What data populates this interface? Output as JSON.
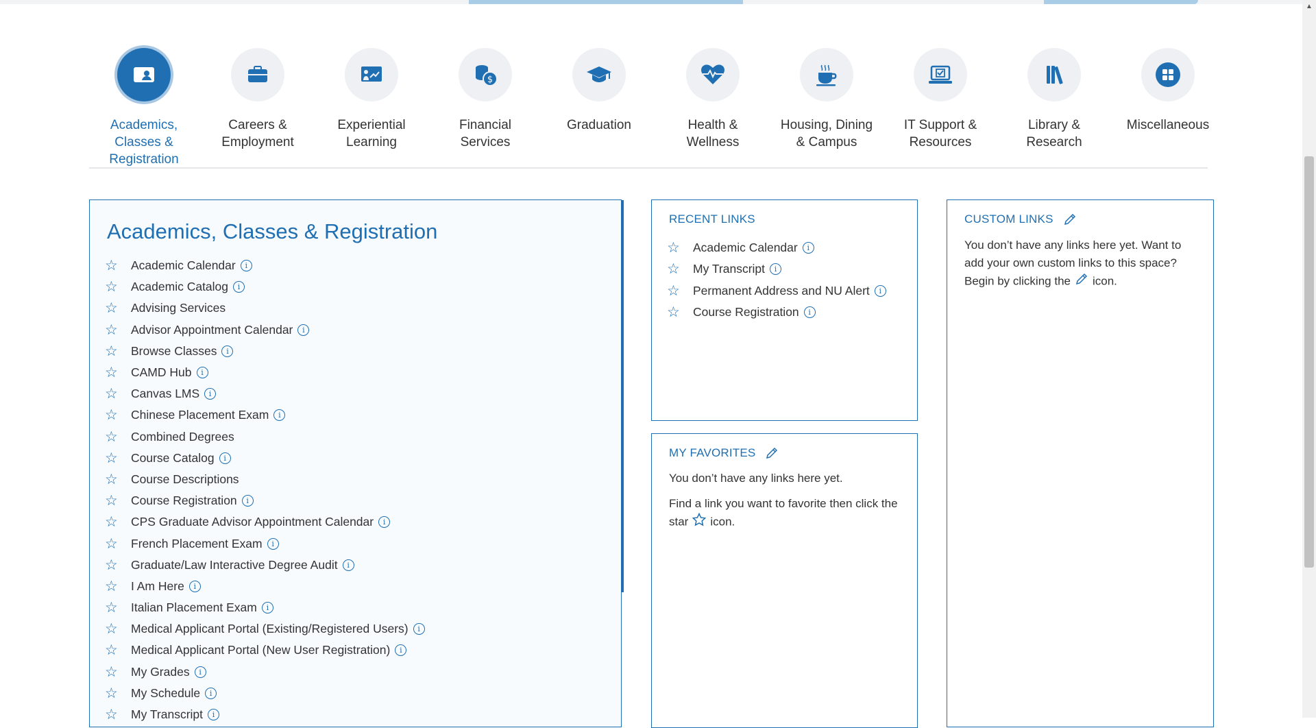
{
  "categories": [
    {
      "label": "Academics,\nClasses &\nRegistration",
      "icon": "id-card-icon",
      "active": true
    },
    {
      "label": "Careers &\nEmployment",
      "icon": "briefcase-icon"
    },
    {
      "label": "Experiential\nLearning",
      "icon": "presentation-icon"
    },
    {
      "label": "Financial\nServices",
      "icon": "coins-icon"
    },
    {
      "label": "Graduation",
      "icon": "graduation-cap-icon"
    },
    {
      "label": "Health &\nWellness",
      "icon": "heartbeat-icon"
    },
    {
      "label": "Housing, Dining\n& Campus",
      "icon": "coffee-cup-icon"
    },
    {
      "label": "IT Support &\nResources",
      "icon": "laptop-icon"
    },
    {
      "label": "Library &\nResearch",
      "icon": "books-icon"
    },
    {
      "label": "Miscellaneous",
      "icon": "grid-icon"
    }
  ],
  "main": {
    "title": "Academics, Classes & Registration",
    "links": [
      {
        "label": "Academic Calendar",
        "info": true
      },
      {
        "label": "Academic Catalog",
        "info": true
      },
      {
        "label": "Advising Services",
        "info": false
      },
      {
        "label": "Advisor Appointment Calendar",
        "info": true
      },
      {
        "label": "Browse Classes",
        "info": true
      },
      {
        "label": "CAMD Hub",
        "info": true
      },
      {
        "label": "Canvas LMS",
        "info": true
      },
      {
        "label": "Chinese Placement Exam",
        "info": true
      },
      {
        "label": "Combined Degrees",
        "info": false
      },
      {
        "label": "Course Catalog",
        "info": true
      },
      {
        "label": "Course Descriptions",
        "info": false
      },
      {
        "label": "Course Registration",
        "info": true
      },
      {
        "label": "CPS Graduate Advisor Appointment Calendar",
        "info": true
      },
      {
        "label": "French Placement Exam",
        "info": true
      },
      {
        "label": "Graduate/Law Interactive Degree Audit",
        "info": true
      },
      {
        "label": "I Am Here",
        "info": true
      },
      {
        "label": "Italian Placement Exam",
        "info": true
      },
      {
        "label": "Medical Applicant Portal (Existing/Registered Users)",
        "info": true
      },
      {
        "label": "Medical Applicant Portal (New User Registration)",
        "info": true
      },
      {
        "label": "My Grades",
        "info": true
      },
      {
        "label": "My Schedule",
        "info": true
      },
      {
        "label": "My Transcript",
        "info": true
      }
    ]
  },
  "recent": {
    "heading": "RECENT LINKS",
    "links": [
      {
        "label": "Academic Calendar"
      },
      {
        "label": "My Transcript"
      },
      {
        "label": "Permanent Address and NU Alert"
      },
      {
        "label": "Course Registration"
      }
    ]
  },
  "favorites": {
    "heading": "MY FAVORITES",
    "empty": "You don’t have any links here yet.",
    "hint_before": "Find a link you want to favorite then click the star",
    "hint_after": "icon."
  },
  "custom": {
    "heading": "CUSTOM LINKS",
    "text_before": "You don’t have any links here yet. Want to add your own custom links to this space? Begin by clicking the",
    "text_after": "icon."
  },
  "colors": {
    "accent": "#1f6fb2",
    "accent_light": "#a8c7e3",
    "icon_bg": "#eef0f3"
  }
}
